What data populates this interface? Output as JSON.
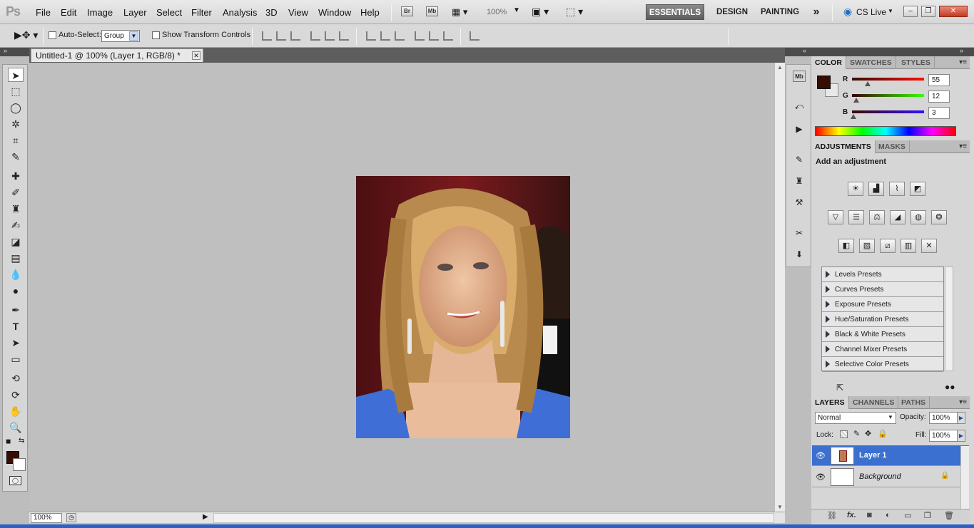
{
  "app": {
    "logo_text": "Ps",
    "menu": [
      "File",
      "Edit",
      "Image",
      "Layer",
      "Select",
      "Filter",
      "Analysis",
      "3D",
      "View",
      "Window",
      "Help"
    ],
    "bridge_buttons": [
      "Br",
      "Mb"
    ],
    "zoom_display": "100%",
    "workspaces": [
      "ESSENTIALS",
      "DESIGN",
      "PAINTING"
    ],
    "overflow_glyph": "»",
    "cs_live": "CS Live",
    "window_controls": [
      "–",
      "❐",
      "✕"
    ]
  },
  "options": {
    "auto_select_label": "Auto-Select:",
    "auto_select_value": "Group",
    "show_transform_label": "Show Transform Controls"
  },
  "document": {
    "tab_title": "Untitled-1 @ 100% (Layer 1, RGB/8) *",
    "close_glyph": "✕",
    "zoom_status": "100%"
  },
  "color_panel": {
    "tabs": [
      "COLOR",
      "SWATCHES",
      "STYLES"
    ],
    "foreground_hex": "#370c03",
    "channels": [
      {
        "label": "R",
        "value": "55"
      },
      {
        "label": "G",
        "value": "12"
      },
      {
        "label": "B",
        "value": "3"
      }
    ]
  },
  "adjustments_panel": {
    "tabs": [
      "ADJUSTMENTS",
      "MASKS"
    ],
    "title": "Add an adjustment",
    "presets": [
      "Levels Presets",
      "Curves Presets",
      "Exposure Presets",
      "Hue/Saturation Presets",
      "Black & White Presets",
      "Channel Mixer Presets",
      "Selective Color Presets"
    ]
  },
  "layers_panel": {
    "tabs": [
      "LAYERS",
      "CHANNELS",
      "PATHS"
    ],
    "blend_mode": "Normal",
    "opacity_label": "Opacity:",
    "opacity_value": "100%",
    "lock_label": "Lock:",
    "fill_label": "Fill:",
    "fill_value": "100%",
    "layers": [
      {
        "name": "Layer 1",
        "selected": true
      },
      {
        "name": "Background",
        "locked": true
      }
    ],
    "bottom_icons": [
      "link-icon",
      "fx-icon",
      "mask-icon",
      "adjustment-icon",
      "group-icon",
      "new-layer-icon",
      "trash-icon"
    ]
  }
}
